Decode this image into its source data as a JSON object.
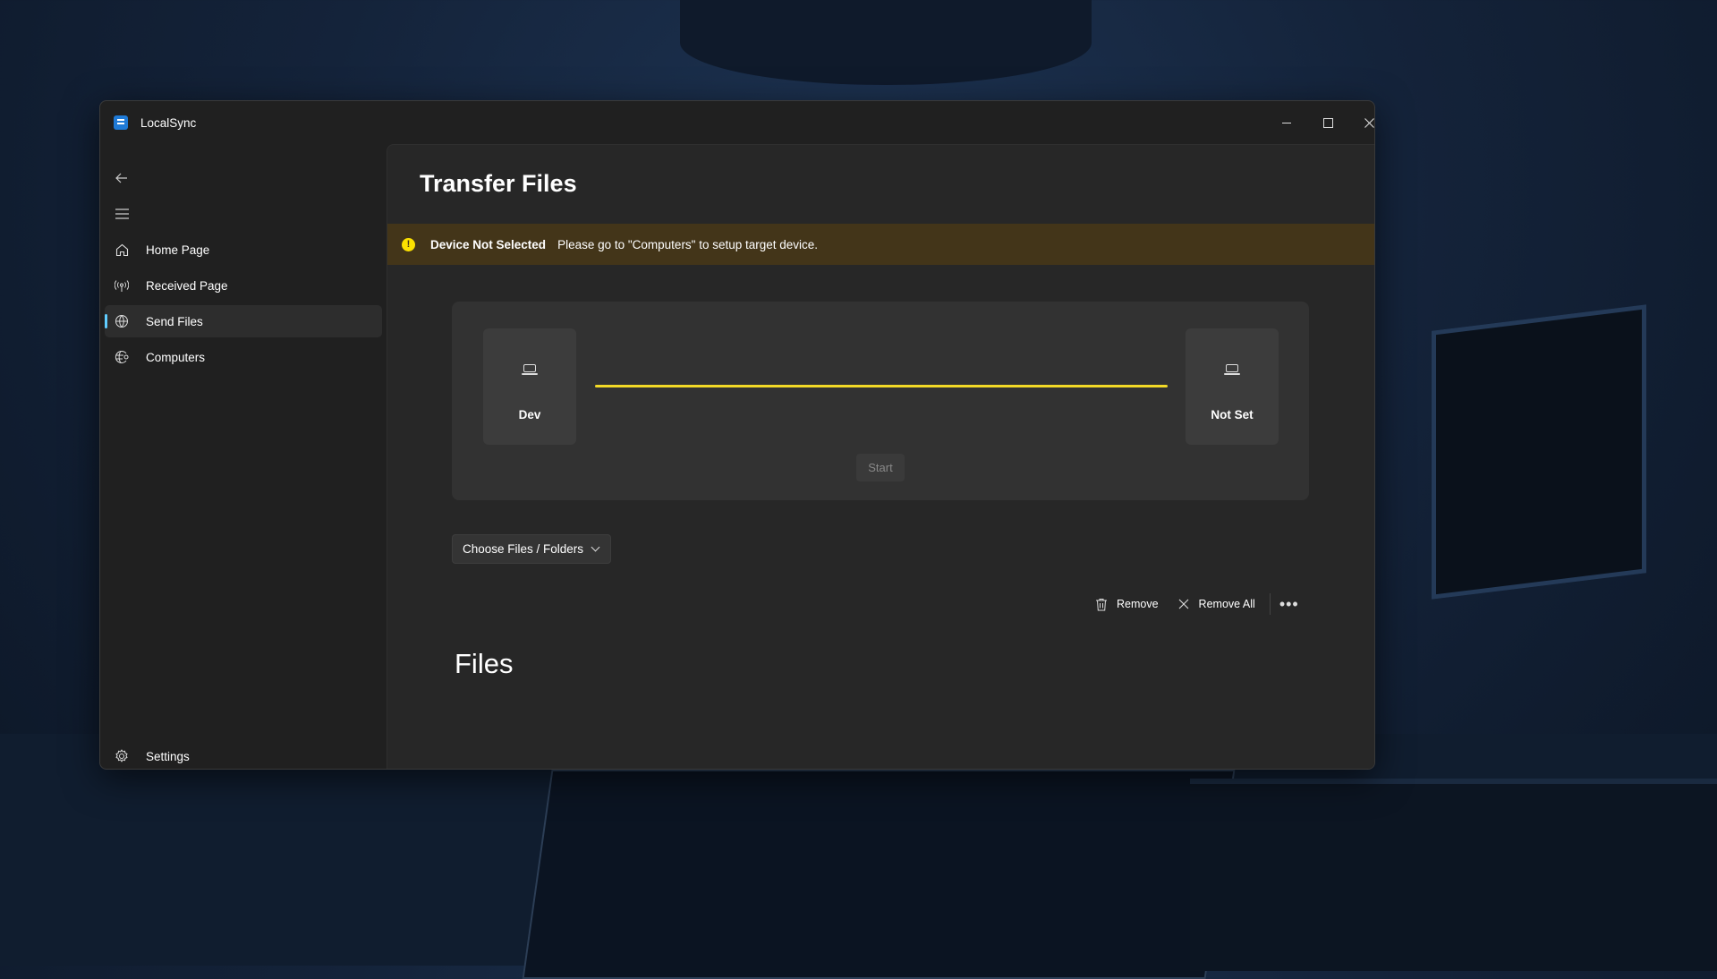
{
  "window": {
    "title": "LocalSync"
  },
  "sidebar": {
    "items": [
      {
        "label": "Home Page",
        "icon": "home-icon"
      },
      {
        "label": "Received Page",
        "icon": "broadcast-icon"
      },
      {
        "label": "Send Files",
        "icon": "globe-icon",
        "selected": true
      },
      {
        "label": "Computers",
        "icon": "network-globe-icon"
      }
    ],
    "settings": {
      "label": "Settings",
      "icon": "gear-icon"
    }
  },
  "page": {
    "title": "Transfer Files"
  },
  "info_bar": {
    "severity": "warning",
    "title": "Device Not Selected",
    "message": "Please go to \"Computers\" to setup target device."
  },
  "transfer": {
    "source_device": "Dev",
    "target_device": "Not Set",
    "start_label": "Start",
    "start_enabled": false,
    "line_color": "#f2d927"
  },
  "choose_button": {
    "label": "Choose Files / Folders"
  },
  "command_bar": {
    "remove_label": "Remove",
    "remove_all_label": "Remove All",
    "more_label": "•••"
  },
  "files": {
    "heading": "Files"
  },
  "colors": {
    "accent": "#60cdff",
    "warning_bg": "#433519",
    "warning_icon": "#fce100"
  }
}
